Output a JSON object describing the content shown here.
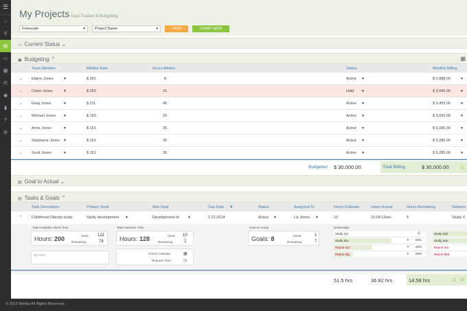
{
  "header": {
    "title": "My Projects",
    "subtitle": "Goal Tracker & Budgeting"
  },
  "filters": {
    "company": "Freescale",
    "project": "Project Name",
    "view_label": "VIEW",
    "start_label": "START NEW"
  },
  "sections": {
    "current_status": "Current Status",
    "budgeting": "Budgeting",
    "goal_to_actual": "Goal to Actual",
    "tasks_goals": "Tasks & Goals"
  },
  "budget": {
    "columns": [
      "Team Member",
      "Billable Rate",
      "Hours Alloted",
      "Status",
      "Monthly Billing"
    ],
    "rows": [
      {
        "name": "Elaine Jones",
        "rate": "$ 361",
        "hours": "8",
        "status": "Active",
        "billing": "$ 2,888.00"
      },
      {
        "name": "Claire Jones",
        "rate": "$ 263",
        "hours": "15",
        "status": "Hold",
        "billing": "$ 3,945.00"
      },
      {
        "name": "Greg Jones",
        "rate": "$ 211",
        "hours": "45",
        "status": "Active",
        "billing": "$ 9,455.00"
      },
      {
        "name": "Michael Jones",
        "rate": "$ 183",
        "hours": "20",
        "status": "Active",
        "billing": "$ 3,660.00"
      },
      {
        "name": "Anne Jones",
        "rate": "$ 151",
        "hours": "35",
        "status": "Active",
        "billing": "$ 5,285.00"
      },
      {
        "name": "Stephanie Jones",
        "rate": "$ 151",
        "hours": "35",
        "status": "Active",
        "billing": "$ 5,285.00"
      },
      {
        "name": "Scott Jones",
        "rate": "$ 151",
        "hours": "35",
        "status": "Active",
        "billing": "$ 5,285.00"
      }
    ],
    "budgeted_label": "Budgeted",
    "budgeted_value": "$ 30,000.00",
    "total_label": "Total Billing",
    "total_value": "$ 30,000.00"
  },
  "tasks": {
    "columns": [
      "Task Description",
      "Primary Goal",
      "Mini Goal",
      "Due Date",
      "Status",
      "Assigned To",
      "Hours Estimate",
      "Hours Actual",
      "Hours Remaining",
      "Delivere"
    ],
    "row": {
      "desc": "Childhood Obesity study",
      "primary": "Study development",
      "mini": "Development of",
      "due": "2.21.2014",
      "status": "Active",
      "assigned": "Liz Jones",
      "estimate": "10",
      "actual": "10:54:13sec",
      "remaining": "5",
      "deliver": "Study X"
    },
    "client": {
      "label": "Total Available Client Time",
      "hours_label": "Hours:",
      "hours": "200",
      "used_label": "Used",
      "used": "122",
      "remaining_label": "Remaining",
      "remaining": "78"
    },
    "team": {
      "label": "Team Member Time",
      "hours_label": "Hours:",
      "hours": "128",
      "used_label": "Used",
      "used": "10",
      "remaining_label": "Remaining",
      "remaining": "2"
    },
    "goal": {
      "label": "Goal to Actual",
      "goals_label": "Goals:",
      "goals": "8",
      "actual_label": "Actual",
      "actual": "1",
      "remaining_label": "Remaining",
      "remaining": "7"
    },
    "note_placeholder": "My Note",
    "check_calendar": "Check Calendar",
    "request_time": "Request Time",
    "deliverable_label": "Deliverable",
    "deliverables": [
      {
        "name": "Study xyz",
        "pct": ""
      },
      {
        "name": "Study abc",
        "pct": "60%"
      },
      {
        "name": "Report xyz",
        "pct": "40%"
      },
      {
        "name": "Report dfg",
        "pct": "20%"
      }
    ],
    "deliverables2": [
      "Study kdd",
      "Study aaa",
      "Report sss",
      "Report bbb"
    ],
    "totals": {
      "estimate": "51.5 hrs",
      "actual": "36.92 hrs",
      "remaining": "14.58 hrs",
      "or": "Or"
    }
  },
  "footer": "© 2013 Wallop All Rights Reserved.",
  "colors": {
    "accent_green": "#8cc63f",
    "orange": "#f7a944",
    "blue": "#3a7bb0"
  }
}
